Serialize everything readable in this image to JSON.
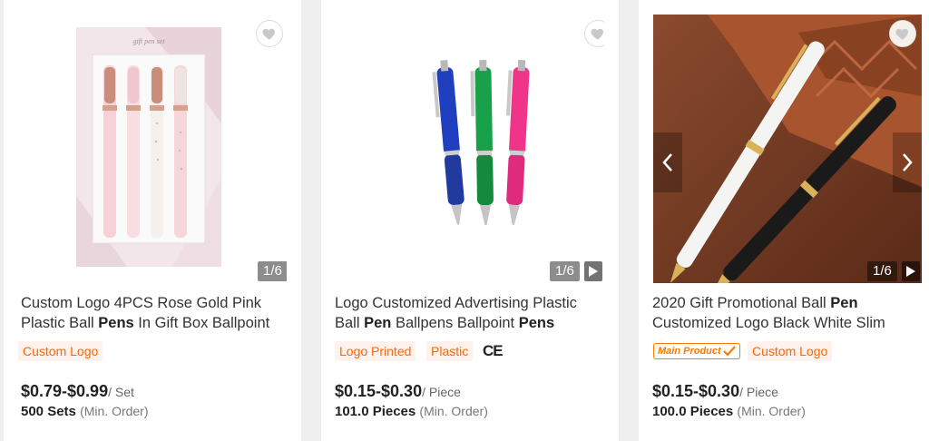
{
  "products": [
    {
      "title_parts": [
        {
          "text": "Custom Logo 4PCS Rose Gold Pink Plastic Ball ",
          "bold": false
        },
        {
          "text": "Pens",
          "bold": true
        },
        {
          "text": " In Gift Box Ballpoint",
          "bold": false
        }
      ],
      "gift_box_text": "gift pen set",
      "image_counter": "1/6",
      "tags": [
        "Custom Logo"
      ],
      "price": "$0.79-$0.99",
      "price_unit": "/ Set",
      "moq": "500 Sets",
      "moq_note": "(Min. Order)"
    },
    {
      "title_parts": [
        {
          "text": "Logo Customized Advertising Plastic Ball ",
          "bold": false
        },
        {
          "text": "Pen",
          "bold": true
        },
        {
          "text": " Ballpens Ballpoint ",
          "bold": false
        },
        {
          "text": "Pens",
          "bold": true
        }
      ],
      "image_counter": "1/6",
      "tags": [
        "Logo Printed",
        "Plastic"
      ],
      "cert": "CE",
      "price": "$0.15-$0.30",
      "price_unit": "/ Piece",
      "moq": "101.0 Pieces",
      "moq_note": "(Min. Order)"
    },
    {
      "title_parts": [
        {
          "text": "2020 Gift Promotional Ball ",
          "bold": false
        },
        {
          "text": "Pen",
          "bold": true
        },
        {
          "text": " Customized Logo Black White Slim",
          "bold": false
        }
      ],
      "image_counter": "1/6",
      "badge": "Main Product",
      "tags": [
        "Custom Logo"
      ],
      "price": "$0.15-$0.30",
      "price_unit": "/ Piece",
      "moq": "100.0 Pieces",
      "moq_note": "(Min. Order)"
    }
  ],
  "colors": {
    "accent": "#ff6600",
    "tag_bg": "#fff1eb",
    "page_bg": "#efefef"
  },
  "icons": {
    "favorite": "heart-icon",
    "video": "play-icon",
    "prev": "chevron-left-icon",
    "next": "chevron-right-icon"
  }
}
